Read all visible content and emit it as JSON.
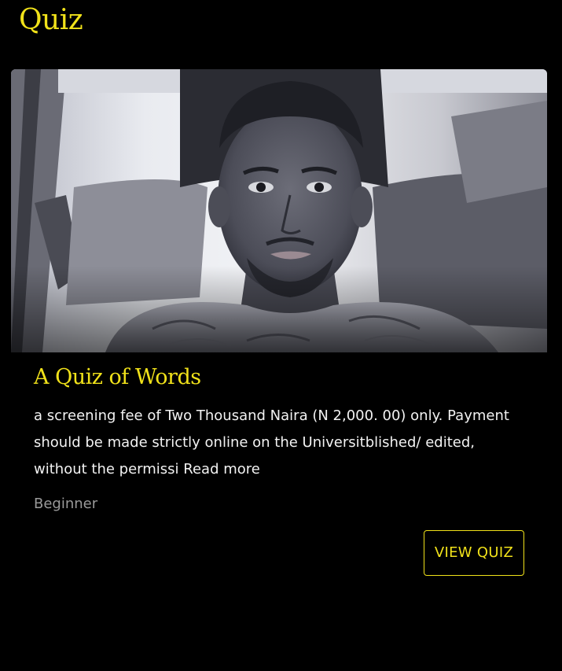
{
  "page": {
    "title": "Quiz"
  },
  "quiz_card": {
    "image_alt": "Quiz cover photo",
    "title": "A Quiz of Words",
    "description": "a screening fee of Two Thousand Naira (N 2,000. 00) only. Payment should be made strictly online on the Universitblished/ edited, without the permissi",
    "read_more_label": "Read more",
    "level": "Beginner",
    "view_button_label": "VIEW QUIZ"
  },
  "colors": {
    "background": "#000000",
    "accent": "#f1e21a",
    "body_text": "#f2f2f2",
    "muted_text": "#9a9a9a"
  }
}
